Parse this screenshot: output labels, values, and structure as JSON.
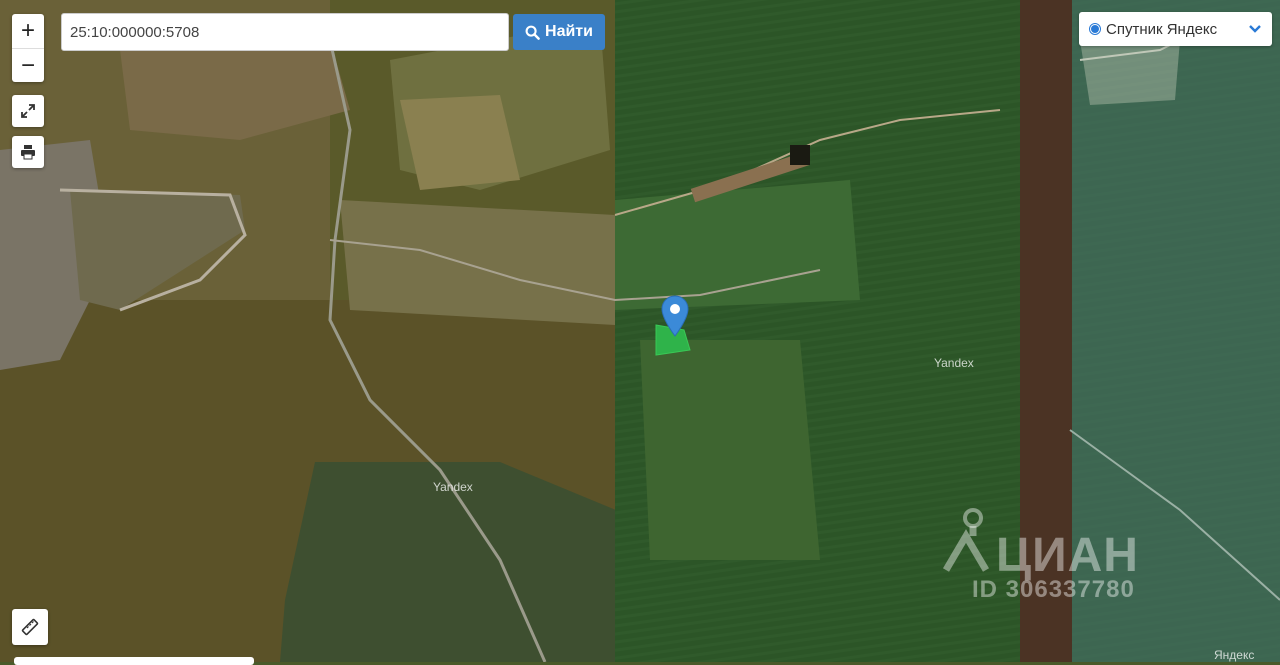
{
  "search": {
    "value": "25:10:000000:5708",
    "button_label": "Найти"
  },
  "controls": {
    "zoom_in_label": "+",
    "zoom_out_label": "−",
    "fullscreen_icon": "expand-icon",
    "print_icon": "print-icon",
    "ruler_icon": "ruler-icon"
  },
  "layer": {
    "selected": "Спутник Яндекс"
  },
  "map": {
    "provider_labels": [
      "Yandex",
      "Yandex",
      "Яндекс"
    ],
    "marker_color": "#3b8ad8",
    "parcel_color": "#2fb34a"
  },
  "watermark": {
    "brand": "ЦИАН",
    "id_text": "ID 306337780"
  },
  "colors": {
    "accent": "#3a80c8"
  }
}
